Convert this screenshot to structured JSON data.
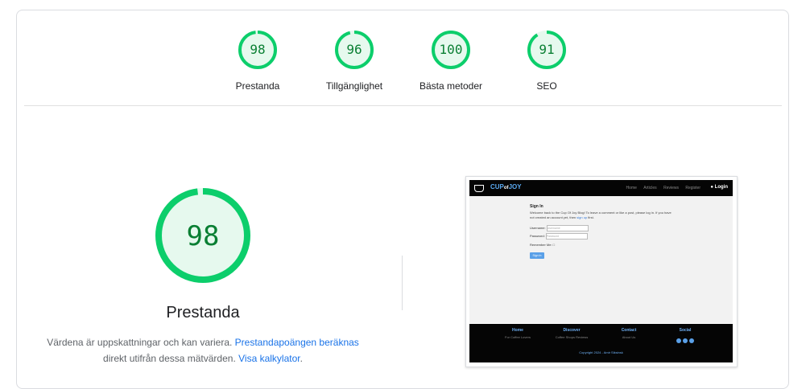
{
  "summary": {
    "gauges": [
      {
        "score": "98",
        "label": "Prestanda"
      },
      {
        "score": "96",
        "label": "Tillgänglighet"
      },
      {
        "score": "100",
        "label": "Bästa metoder"
      },
      {
        "score": "91",
        "label": "SEO"
      }
    ]
  },
  "main": {
    "score": "98",
    "title": "Prestanda",
    "desc_text1": "Värdena är uppskattningar och kan variera. ",
    "desc_link1": "Prestandapoängen beräknas",
    "desc_text2": "direkt utifrån dessa mätvärden. ",
    "desc_link2": "Visa kalkylator",
    "desc_end": "."
  },
  "colors": {
    "pass": "#0cce6b",
    "pass_text": "#0a7f33",
    "pass_bg": "#e6f9ee"
  },
  "screenshot": {
    "brand_cup": "CUP",
    "brand_of": "of",
    "brand_joy": "JOY",
    "nav_links": [
      "Home",
      "Articles",
      "Reviews",
      "Register"
    ],
    "login": "Login",
    "heading": "Sign In",
    "intro": "Welcome back to the Cup Of Joy Blog! To leave a comment or like a post, please log in. If you have not created an account yet, then ",
    "intro_link": "sign up",
    "intro_end": " first.",
    "username_label": "Username:",
    "username_placeholder": "Username",
    "password_label": "Password:",
    "password_placeholder": "Password",
    "remember_label": "Remember Me:",
    "signin_button": "Sign In",
    "footer": [
      {
        "title": "Home",
        "sub": "For Coffee Lovers"
      },
      {
        "title": "Discover",
        "sub": "Coffee Shops Reviews"
      },
      {
        "title": "Contact",
        "sub": "About Us"
      },
      {
        "title": "Social",
        "sub": ""
      }
    ],
    "copyright": "Copyright 2024 - Amir Siksinsk"
  }
}
